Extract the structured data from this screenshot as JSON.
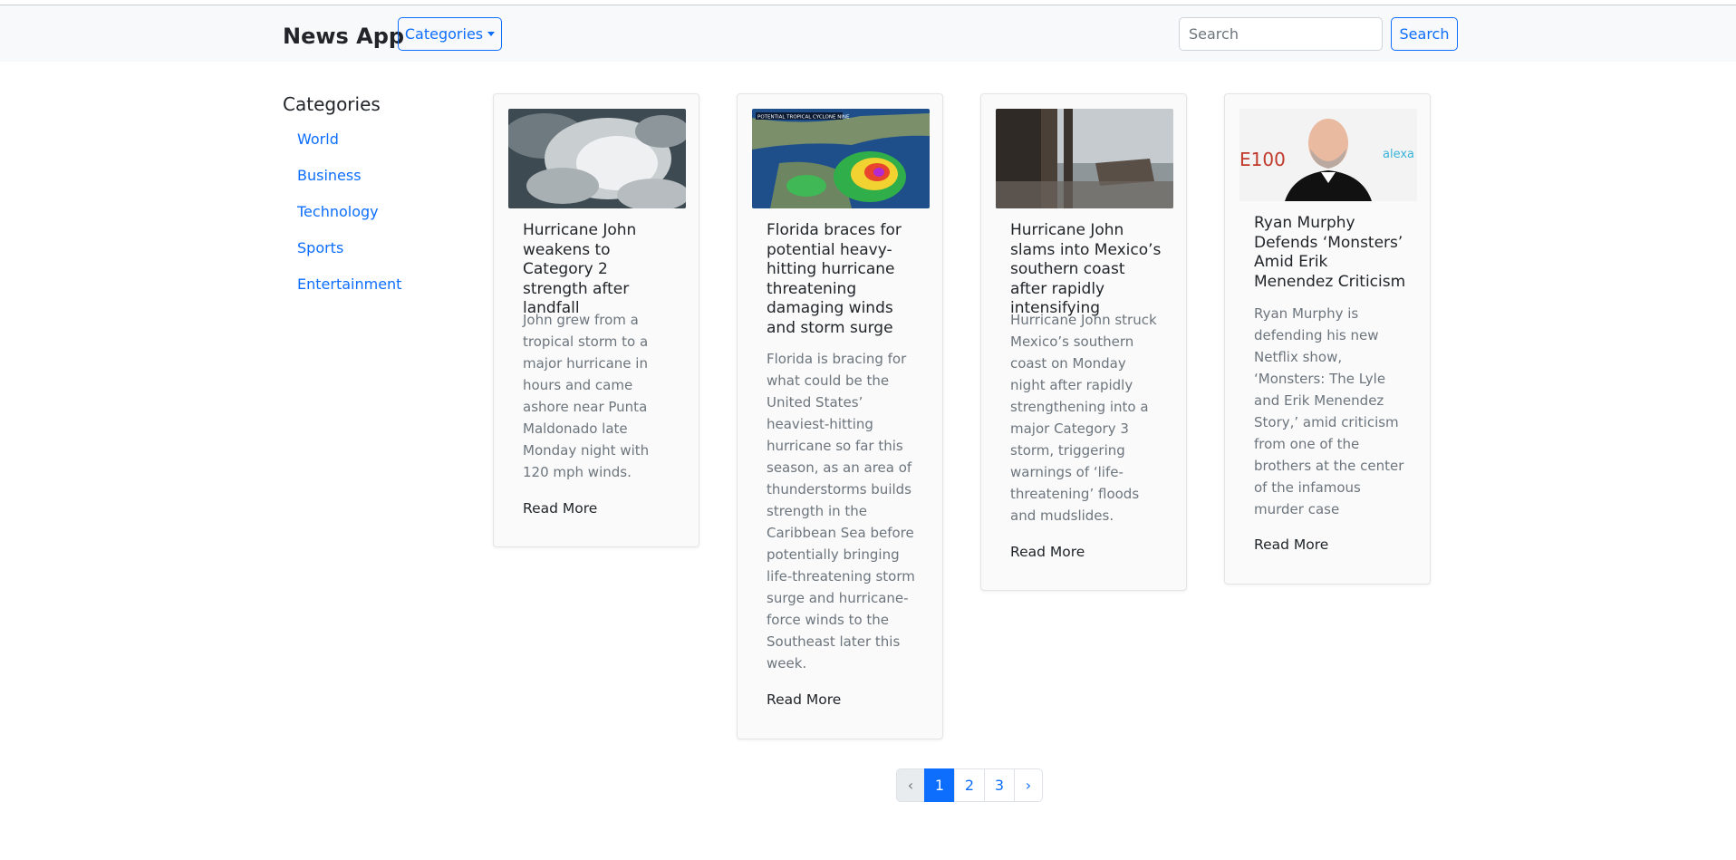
{
  "navbar": {
    "brand": "News App",
    "categories_button": "Categories",
    "search_placeholder": "Search",
    "search_button": "Search"
  },
  "sidebar": {
    "title": "Categories",
    "items": [
      {
        "label": "World"
      },
      {
        "label": "Business"
      },
      {
        "label": "Technology"
      },
      {
        "label": "Sports"
      },
      {
        "label": "Entertainment"
      }
    ]
  },
  "articles": [
    {
      "title": "Hurricane John weakens to Category 2 strength after landfall",
      "description": "John grew from a tropical storm to a major hurricane in hours and came ashore near Punta Maldonado late Monday night with 120 mph winds.",
      "link_label": "Read More",
      "image": "satellite-cloud-photo"
    },
    {
      "title": "Florida braces for potential heavy-hitting hurricane threatening damaging winds and storm surge",
      "description": "Florida is bracing for what could be the United States’ heaviest-hitting hurricane so far this season, as an area of thunderstorms builds strength in the Caribbean Sea before potentially bringing life-threatening storm surge and hurricane-force winds to the Southeast later this week.",
      "link_label": "Read More",
      "image": "weather-radar-map",
      "image_caption": "POTENTIAL TROPICAL CYCLONE NINE"
    },
    {
      "title": "Hurricane John slams into Mexico’s southern coast after rapidly intensifying",
      "description": "Hurricane John struck Mexico’s southern coast on Monday night after rapidly strengthening into a major Category 3 storm, triggering warnings of ‘life-threatening’ floods and mudslides.",
      "link_label": "Read More",
      "image": "flooded-coast-photo"
    },
    {
      "title": "Ryan Murphy Defends ‘Monsters’ Amid Erik Menendez Criticism",
      "description": "Ryan Murphy is defending his new Netflix show, ‘Monsters: The Lyle and Erik Menendez Story,’ amid criticism from one of the brothers at the center of the infamous murder case",
      "link_label": "Read More",
      "image": "portrait-photo",
      "image_text_left": "E100",
      "image_text_right": "alexa"
    }
  ],
  "pagination": {
    "prev": "‹",
    "pages": [
      "1",
      "2",
      "3"
    ],
    "current": "1",
    "next": "›"
  },
  "colors": {
    "accent": "#0d6efd",
    "navbar_bg": "#f8f9fa",
    "muted_text": "#6c757d"
  }
}
